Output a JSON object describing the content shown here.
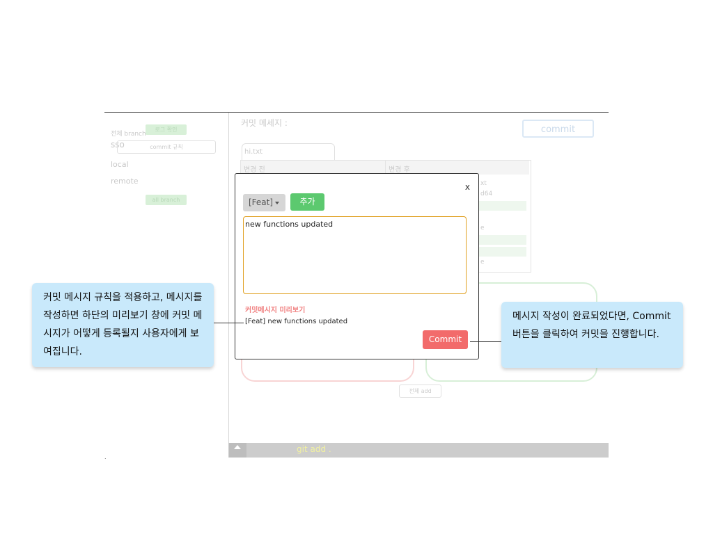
{
  "background": {
    "sidebar": {
      "all_branch_label": "전체 branch",
      "rule_button": "로그 확인",
      "branch_input": "sso",
      "commit_rule_label": "commit 규칙",
      "local": "local",
      "remote": "remote",
      "all_branch_button": "all branch"
    },
    "commit_message_label": "커밋 메세지 :",
    "commit_top_button": "commit",
    "file_tab": "hi.txt",
    "diff": {
      "before": "변경 전",
      "after": "변경 후",
      "after_lines": [
        "xt",
        "d64",
        "",
        "",
        "e",
        "",
        "",
        "e"
      ]
    },
    "stage_all": "전체 add",
    "bottom_bar_text": "git add ."
  },
  "modal": {
    "close": "x",
    "type_select": "[Feat]",
    "add_button": "추가",
    "message_value": "new functions updated",
    "preview_label": "커밋메시지 미리보기",
    "preview_text": "[Feat] new functions updated",
    "commit_button": "Commit"
  },
  "callouts": {
    "left": "커밋 메시지 규칙을 적용하고, 메시지를 작성하면 하단의 미리보기 창에 커밋 메시지가 어떻게 등록될지 사용자에게 보여집니다.",
    "right": "메시지 작성이 완료되었다면, Commit 버튼을 클릭하여 커밋을 진행합니다."
  },
  "colors": {
    "accent_green": "#5cc96f",
    "commit_red": "#f26b6b",
    "focus_border": "#e0a020",
    "callout_bg": "#c9e9fb"
  }
}
